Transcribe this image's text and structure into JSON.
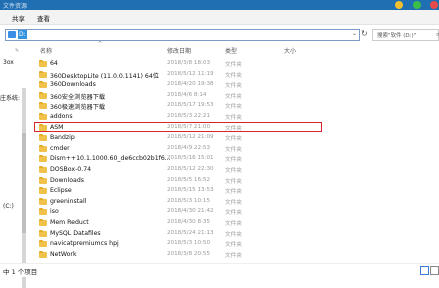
{
  "window": {
    "title": "文件资源"
  },
  "ribbon": {
    "tabs": [
      {
        "label": "共享"
      },
      {
        "label": "查看"
      }
    ]
  },
  "address": {
    "path": "D:"
  },
  "search": {
    "placeholder": "搜索\"软件 (D:)\""
  },
  "nav": {
    "items": [
      "3ox",
      "庄系统:",
      "(C:)"
    ]
  },
  "columns": {
    "name": "名称",
    "date": "修改日期",
    "type": "类型",
    "size": "大小"
  },
  "files": [
    {
      "name": "64",
      "date": "2018/3/8 18:03",
      "type": "文件夹"
    },
    {
      "name": "360DesktopLite (11.0.0.1141) 64位",
      "date": "2018/5/12 11:19",
      "type": "文件夹"
    },
    {
      "name": "360Downloads",
      "date": "2018/4/20 19:38",
      "type": "文件夹"
    },
    {
      "name": "360安全浏览器下载",
      "date": "2018/4/6 8:14",
      "type": "文件夹"
    },
    {
      "name": "360极速浏览器下载",
      "date": "2018/5/17 19:53",
      "type": "文件夹"
    },
    {
      "name": "addons",
      "date": "2018/5/3 22:21",
      "type": "文件夹"
    },
    {
      "name": "ASM",
      "date": "2018/5/7 21:00",
      "type": "文件夹"
    },
    {
      "name": "Bandzip",
      "date": "2018/5/12 21:09",
      "type": "文件夹"
    },
    {
      "name": "cmder",
      "date": "2018/4/9 22:53",
      "type": "文件夹"
    },
    {
      "name": "Dism++10.1.1000.60_de6ccb02b1f6...",
      "date": "2018/5/16 15:01",
      "type": "文件夹"
    },
    {
      "name": "DOSBox-0.74",
      "date": "2018/5/12 22:30",
      "type": "文件夹"
    },
    {
      "name": "Downloads",
      "date": "2018/5/5 16:52",
      "type": "文件夹"
    },
    {
      "name": "Eclipse",
      "date": "2018/5/15 13:53",
      "type": "文件夹"
    },
    {
      "name": "greeninstall",
      "date": "2018/5/3 10:15",
      "type": "文件夹"
    },
    {
      "name": "iso",
      "date": "2018/4/30 21:42",
      "type": "文件夹"
    },
    {
      "name": "Mem Reduct",
      "date": "2018/4/30 8:35",
      "type": "文件夹"
    },
    {
      "name": "MySQL Datafiles",
      "date": "2018/5/24 21:13",
      "type": "文件夹"
    },
    {
      "name": "navicatpremiumcs hpj",
      "date": "2018/5/3 10:50",
      "type": "文件夹"
    },
    {
      "name": "NetWork",
      "date": "2018/3/8 20:55",
      "type": "文件夹"
    }
  ],
  "status": {
    "text": "中 1 个项目"
  }
}
